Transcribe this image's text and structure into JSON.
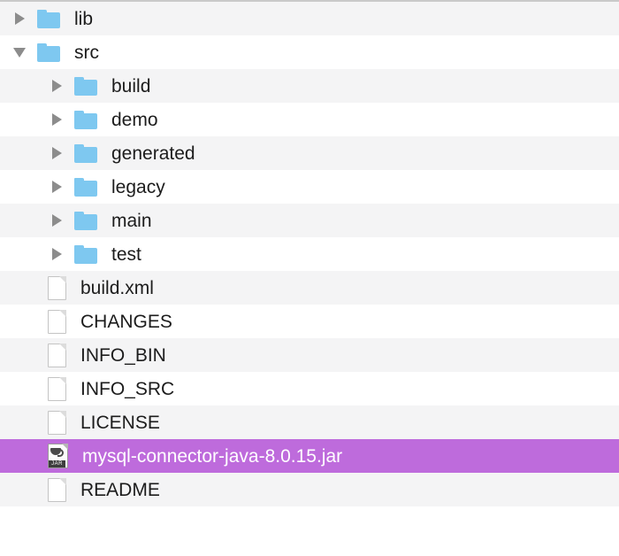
{
  "tree": {
    "title": "file-tree",
    "selected_row_color": "#be6bdc",
    "stripe_color": "#f4f4f5",
    "folder_color": "#7ec8f0",
    "rows": [
      {
        "label": "lib",
        "kind": "folder",
        "icon": "folder-icon",
        "depth": 0,
        "twisty": "collapsed",
        "selected": false
      },
      {
        "label": "src",
        "kind": "folder",
        "icon": "folder-icon",
        "depth": 0,
        "twisty": "expanded",
        "selected": false
      },
      {
        "label": "build",
        "kind": "folder",
        "icon": "folder-icon",
        "depth": 1,
        "twisty": "collapsed",
        "selected": false
      },
      {
        "label": "demo",
        "kind": "folder",
        "icon": "folder-icon",
        "depth": 1,
        "twisty": "collapsed",
        "selected": false
      },
      {
        "label": "generated",
        "kind": "folder",
        "icon": "folder-icon",
        "depth": 1,
        "twisty": "collapsed",
        "selected": false
      },
      {
        "label": "legacy",
        "kind": "folder",
        "icon": "folder-icon",
        "depth": 1,
        "twisty": "collapsed",
        "selected": false
      },
      {
        "label": "main",
        "kind": "folder",
        "icon": "folder-icon",
        "depth": 1,
        "twisty": "collapsed",
        "selected": false
      },
      {
        "label": "test",
        "kind": "folder",
        "icon": "folder-icon",
        "depth": 1,
        "twisty": "collapsed",
        "selected": false
      },
      {
        "label": "build.xml",
        "kind": "file",
        "icon": "document-icon",
        "depth": 0,
        "twisty": "none",
        "selected": false
      },
      {
        "label": "CHANGES",
        "kind": "file",
        "icon": "document-icon",
        "depth": 0,
        "twisty": "none",
        "selected": false
      },
      {
        "label": "INFO_BIN",
        "kind": "file",
        "icon": "document-icon",
        "depth": 0,
        "twisty": "none",
        "selected": false
      },
      {
        "label": "INFO_SRC",
        "kind": "file",
        "icon": "document-icon",
        "depth": 0,
        "twisty": "none",
        "selected": false
      },
      {
        "label": "LICENSE",
        "kind": "file",
        "icon": "document-icon",
        "depth": 0,
        "twisty": "none",
        "selected": false
      },
      {
        "label": "mysql-connector-java-8.0.15.jar",
        "kind": "file",
        "icon": "jar-icon",
        "depth": 0,
        "twisty": "none",
        "selected": true
      },
      {
        "label": "README",
        "kind": "file",
        "icon": "document-icon",
        "depth": 0,
        "twisty": "none",
        "selected": false
      }
    ],
    "jar_icon_label": "JAR"
  }
}
